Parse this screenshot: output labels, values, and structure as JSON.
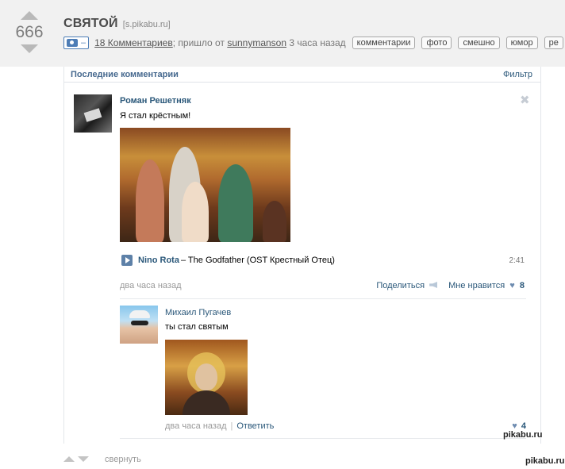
{
  "post": {
    "score": "666",
    "title": "СВЯТОЙ",
    "domain": "[s.pikabu.ru]",
    "media_dash": "–",
    "comments_link": "18 Комментариев",
    "via_text": "; пришло от",
    "author": "sunnymanson",
    "time_ago": "3 часа назад",
    "tags": [
      "комментарии",
      "фото",
      "смешно",
      "юмор",
      "ре"
    ]
  },
  "widget": {
    "title": "Последние комментарии",
    "filter": "Фильтр",
    "comment1": {
      "author": "Роман Решетняк",
      "text": "Я стал крёстным!",
      "close": "✖",
      "audio": {
        "artist": "Nino Rota",
        "title": " – The Godfather (OST Крестный Отец)",
        "duration": "2:41"
      },
      "time": "два часа назад",
      "share": "Поделиться",
      "like": "Мне нравится",
      "likes": "8"
    },
    "comment2": {
      "author": "Михаил Пугачев",
      "text": "ты стал святым",
      "time": "два часа назад",
      "sep": "|",
      "reply": "Ответить",
      "likes": "4"
    }
  },
  "footer": {
    "collapse": "свернуть"
  },
  "watermark": "pikabu.ru"
}
